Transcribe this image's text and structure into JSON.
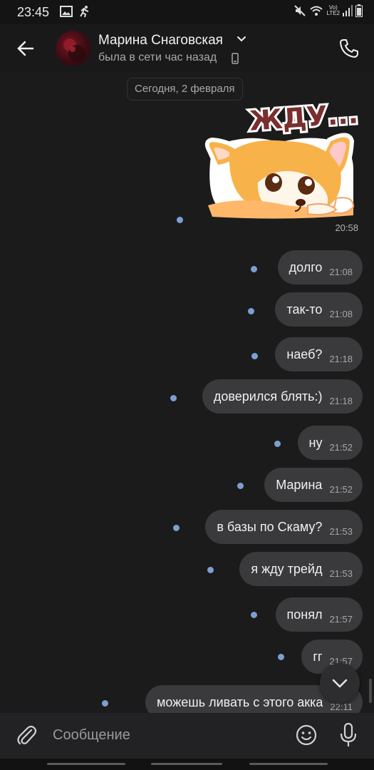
{
  "status_bar": {
    "time": "23:45",
    "network_label_top": "Vo)",
    "network_label_bottom": "LTE2",
    "icons": [
      "image-icon",
      "activity-icon",
      "mute-icon",
      "wifi-icon",
      "signal-icon",
      "battery-icon"
    ]
  },
  "header": {
    "contact_name": "Марина Снаговская",
    "presence": "была в сети час назад",
    "icons": [
      "back-arrow-icon",
      "chevron-down-icon",
      "mobile-phone-icon",
      "call-icon"
    ]
  },
  "date_separator": "Сегодня, 2 февраля",
  "sticker": {
    "caption": "ЖДУ...",
    "time": "20:58"
  },
  "messages": [
    {
      "text": "долго",
      "time": "21:08"
    },
    {
      "text": "так-то",
      "time": "21:08"
    },
    {
      "text": "наеб?",
      "time": "21:18"
    },
    {
      "text": "доверился блять:)",
      "time": "21:18"
    },
    {
      "text": "ну",
      "time": "21:52"
    },
    {
      "text": "Марина",
      "time": "21:52"
    },
    {
      "text": "в базы по Скаму?",
      "time": "21:53"
    },
    {
      "text": "я жду трейд",
      "time": "21:53"
    },
    {
      "text": "понял",
      "time": "21:57"
    },
    {
      "text": "гг",
      "time": "21:57"
    },
    {
      "text": "можешь ливать с этого акка",
      "time": "22:11"
    }
  ],
  "composer": {
    "placeholder": "Сообщение",
    "icons": [
      "paperclip-icon",
      "emoji-icon",
      "microphone-icon"
    ]
  },
  "colors": {
    "background": "#1b1b1c",
    "bubble": "#3a3a3c",
    "unread_dot": "#7d9fd0"
  }
}
